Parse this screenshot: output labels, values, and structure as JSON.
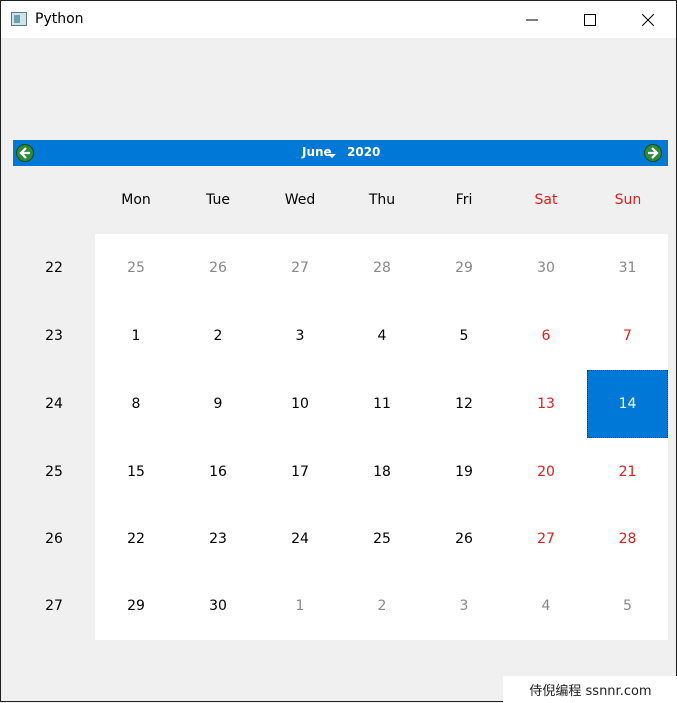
{
  "window": {
    "title": "Python",
    "icon": "python-window-icon"
  },
  "calendar": {
    "month": "June",
    "year": "2020",
    "prev_icon": "arrow-left-icon",
    "next_icon": "arrow-right-icon",
    "colors": {
      "accent": "#0078d7",
      "weekend": "#e0201b",
      "other_month": "#888888"
    },
    "day_headers": [
      "Mon",
      "Tue",
      "Wed",
      "Thu",
      "Fri",
      "Sat",
      "Sun"
    ],
    "weeks": [
      {
        "number": "22",
        "days": [
          "25",
          "26",
          "27",
          "28",
          "29",
          "30",
          "31"
        ]
      },
      {
        "number": "23",
        "days": [
          "1",
          "2",
          "3",
          "4",
          "5",
          "6",
          "7"
        ]
      },
      {
        "number": "24",
        "days": [
          "8",
          "9",
          "10",
          "11",
          "12",
          "13",
          "14"
        ]
      },
      {
        "number": "25",
        "days": [
          "15",
          "16",
          "17",
          "18",
          "19",
          "20",
          "21"
        ]
      },
      {
        "number": "26",
        "days": [
          "22",
          "23",
          "24",
          "25",
          "26",
          "27",
          "28"
        ]
      },
      {
        "number": "27",
        "days": [
          "29",
          "30",
          "1",
          "2",
          "3",
          "4",
          "5"
        ]
      }
    ],
    "selected_date": "14"
  },
  "watermark": "侍倪编程 ssnnr.com"
}
